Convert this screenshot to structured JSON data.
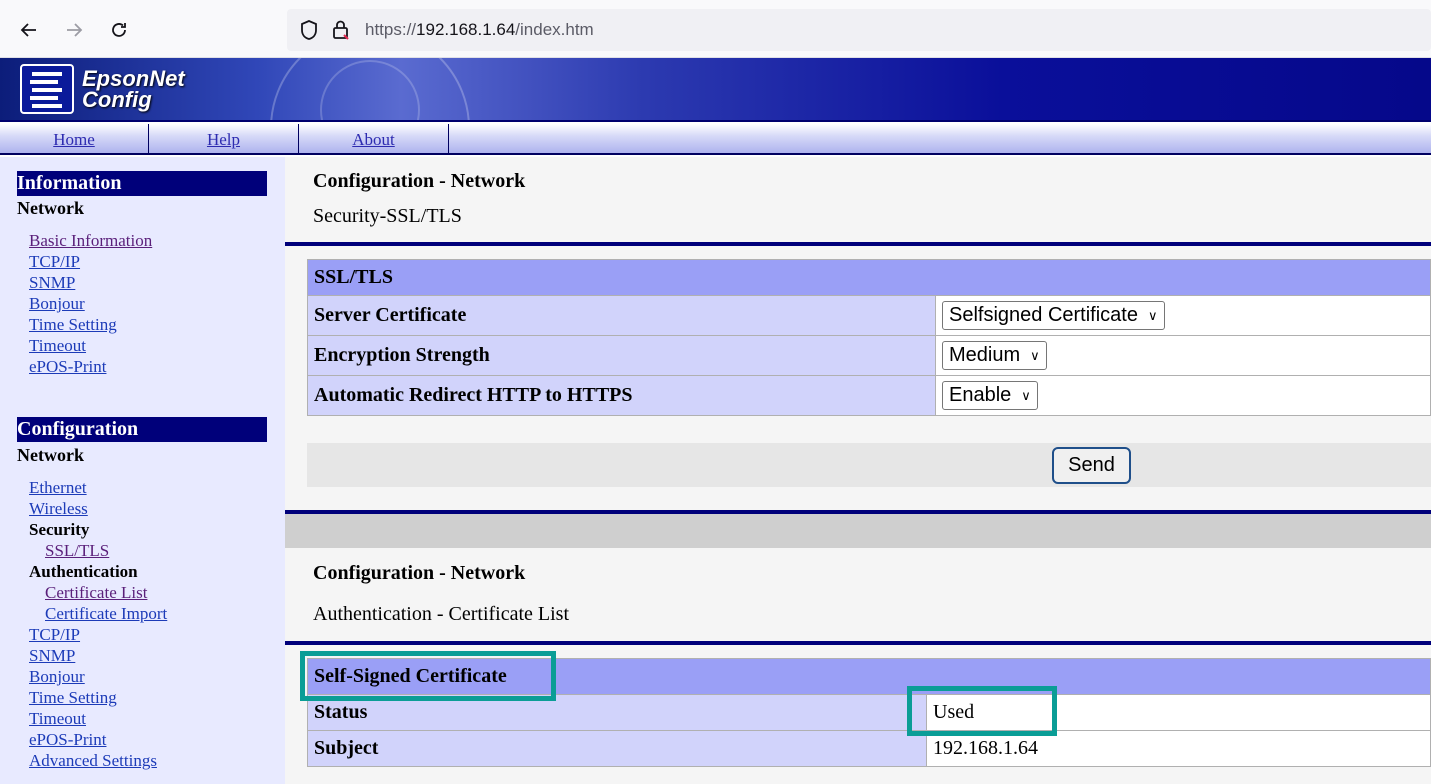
{
  "browser": {
    "url_scheme": "https://",
    "url_host": "192.168.1.64",
    "url_path": "/index.htm"
  },
  "banner": {
    "logo_line1": "EpsonNet",
    "logo_line2": "Config"
  },
  "topmenu": {
    "items": [
      {
        "label": "Home"
      },
      {
        "label": "Help"
      },
      {
        "label": "About"
      }
    ]
  },
  "sidebar": {
    "information": {
      "heading": "Information",
      "subheading": "Network",
      "links": [
        "Basic Information",
        "TCP/IP",
        "SNMP",
        "Bonjour",
        "Time Setting",
        "Timeout",
        "ePOS-Print"
      ]
    },
    "configuration": {
      "heading": "Configuration",
      "subheading": "Network",
      "links_top": [
        "Ethernet",
        "Wireless"
      ],
      "security_label": "Security",
      "security_link": "SSL/TLS",
      "auth_label": "Authentication",
      "auth_links": [
        "Certificate List",
        "Certificate Import"
      ],
      "links_bottom": [
        "TCP/IP",
        "SNMP",
        "Bonjour",
        "Time Setting",
        "Timeout",
        "ePOS-Print",
        "Advanced Settings"
      ]
    }
  },
  "section1": {
    "title": "Configuration - Network",
    "subtitle": "Security-SSL/TLS",
    "table_header": "SSL/TLS",
    "rows": [
      {
        "label": "Server Certificate",
        "value": "Selfsigned Certificate"
      },
      {
        "label": "Encryption Strength",
        "value": "Medium"
      },
      {
        "label": "Automatic Redirect HTTP to HTTPS",
        "value": "Enable"
      }
    ],
    "send_label": "Send"
  },
  "section2": {
    "title": "Configuration - Network",
    "subtitle": "Authentication - Certificate List",
    "table_header": "Self-Signed Certificate",
    "rows": [
      {
        "label": "Status",
        "value": "Used"
      },
      {
        "label": "Subject",
        "value": "192.168.1.64"
      }
    ]
  },
  "colors": {
    "highlight": "#0a9d96",
    "navy": "#00007a",
    "table_header": "#9a9ff6",
    "table_label": "#d1d3fb"
  }
}
